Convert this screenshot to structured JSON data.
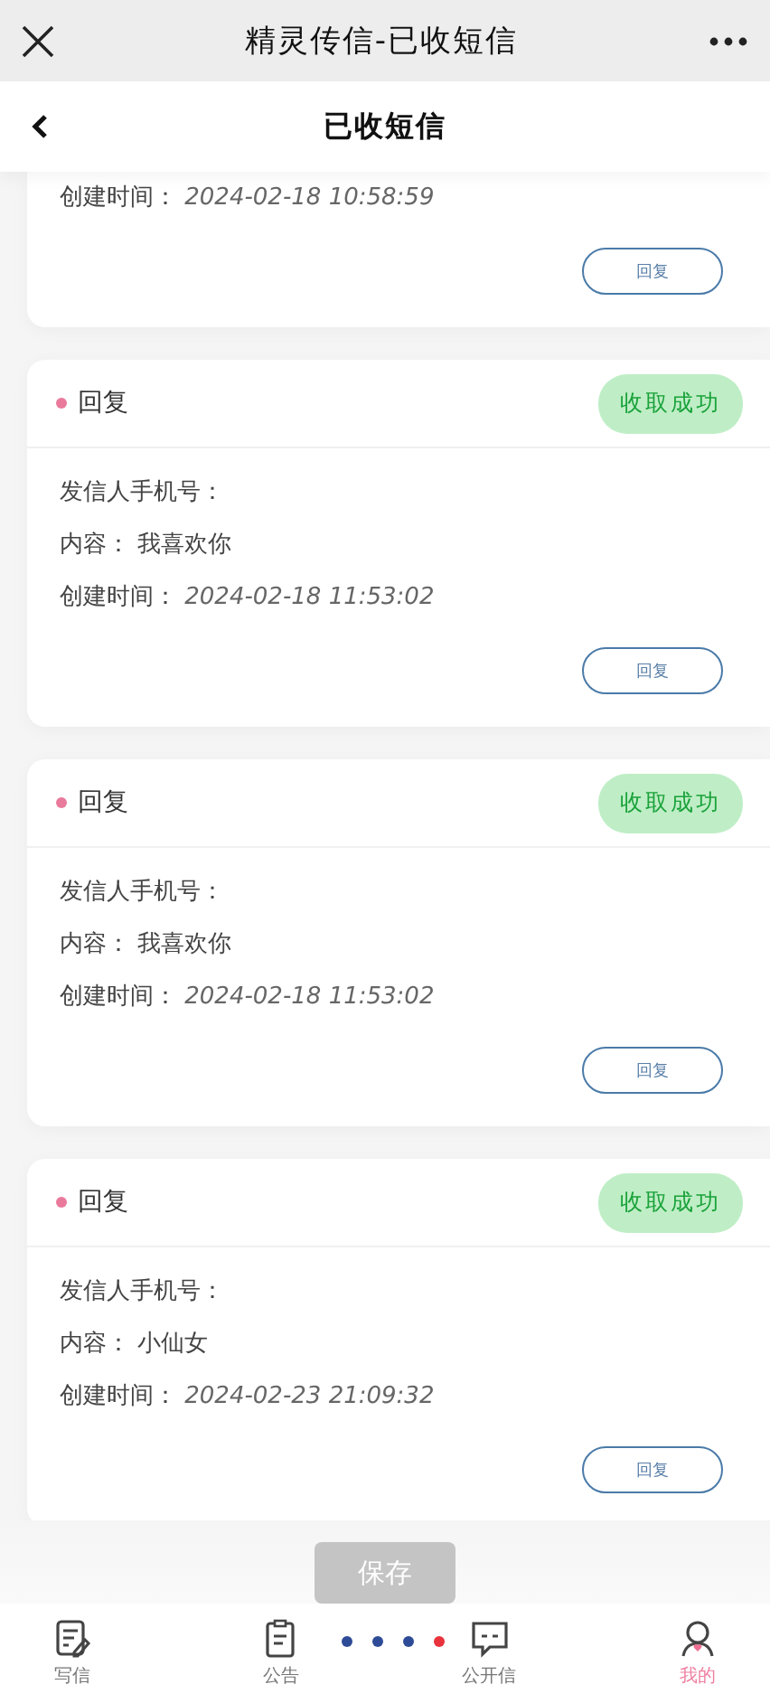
{
  "window": {
    "title": "精灵传信-已收短信"
  },
  "nav": {
    "title": "已收短信"
  },
  "messages": [
    {
      "created_label": "创建时间：",
      "created": "2024-02-18 10:58:59",
      "reply_button": "回复"
    },
    {
      "title": "回复",
      "status": "收取成功",
      "sender_label": "发信人手机号：",
      "content_label": "内容：",
      "content": "我喜欢你",
      "created_label": "创建时间：",
      "created": "2024-02-18 11:53:02",
      "reply_button": "回复"
    },
    {
      "title": "回复",
      "status": "收取成功",
      "sender_label": "发信人手机号：",
      "content_label": "内容：",
      "content": "我喜欢你",
      "created_label": "创建时间：",
      "created": "2024-02-18 11:53:02",
      "reply_button": "回复"
    },
    {
      "title": "回复",
      "status": "收取成功",
      "sender_label": "发信人手机号：",
      "content_label": "内容：",
      "content": "小仙女",
      "created_label": "创建时间：",
      "created": "2024-02-23 21:09:32",
      "reply_button": "回复"
    }
  ],
  "save_button": {
    "label": "保存",
    "disabled": true
  },
  "page_dots": [
    {
      "selected": false
    },
    {
      "selected": false
    },
    {
      "selected": false
    },
    {
      "selected": true
    }
  ],
  "tabs": [
    {
      "kind": "write",
      "label": "写信",
      "selected": false
    },
    {
      "kind": "notice",
      "label": "公告",
      "selected": false
    },
    {
      "kind": "chat",
      "label": "公开信",
      "selected": false
    },
    {
      "kind": "me",
      "label": "我的",
      "selected": true
    }
  ]
}
